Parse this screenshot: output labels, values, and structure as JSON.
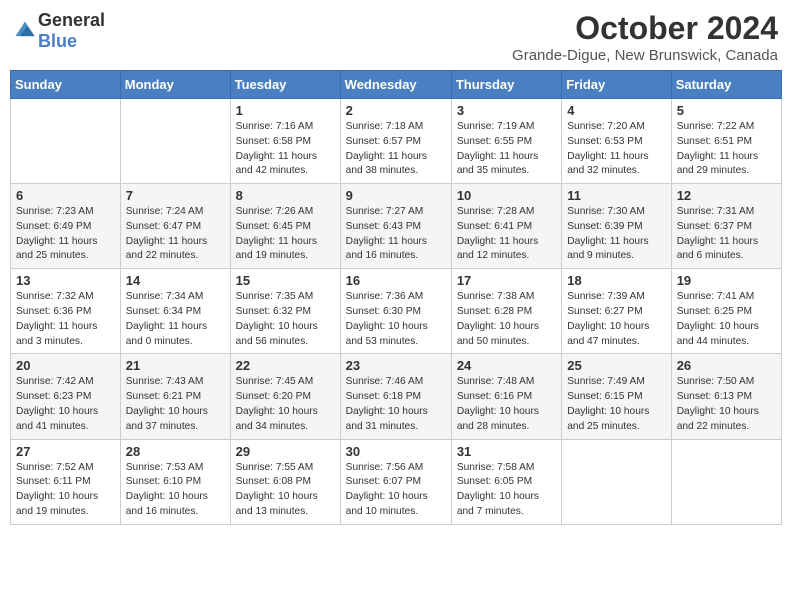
{
  "header": {
    "logo_general": "General",
    "logo_blue": "Blue",
    "month": "October 2024",
    "location": "Grande-Digue, New Brunswick, Canada"
  },
  "days_of_week": [
    "Sunday",
    "Monday",
    "Tuesday",
    "Wednesday",
    "Thursday",
    "Friday",
    "Saturday"
  ],
  "weeks": [
    [
      {
        "day": "",
        "info": ""
      },
      {
        "day": "",
        "info": ""
      },
      {
        "day": "1",
        "info": "Sunrise: 7:16 AM\nSunset: 6:58 PM\nDaylight: 11 hours and 42 minutes."
      },
      {
        "day": "2",
        "info": "Sunrise: 7:18 AM\nSunset: 6:57 PM\nDaylight: 11 hours and 38 minutes."
      },
      {
        "day": "3",
        "info": "Sunrise: 7:19 AM\nSunset: 6:55 PM\nDaylight: 11 hours and 35 minutes."
      },
      {
        "day": "4",
        "info": "Sunrise: 7:20 AM\nSunset: 6:53 PM\nDaylight: 11 hours and 32 minutes."
      },
      {
        "day": "5",
        "info": "Sunrise: 7:22 AM\nSunset: 6:51 PM\nDaylight: 11 hours and 29 minutes."
      }
    ],
    [
      {
        "day": "6",
        "info": "Sunrise: 7:23 AM\nSunset: 6:49 PM\nDaylight: 11 hours and 25 minutes."
      },
      {
        "day": "7",
        "info": "Sunrise: 7:24 AM\nSunset: 6:47 PM\nDaylight: 11 hours and 22 minutes."
      },
      {
        "day": "8",
        "info": "Sunrise: 7:26 AM\nSunset: 6:45 PM\nDaylight: 11 hours and 19 minutes."
      },
      {
        "day": "9",
        "info": "Sunrise: 7:27 AM\nSunset: 6:43 PM\nDaylight: 11 hours and 16 minutes."
      },
      {
        "day": "10",
        "info": "Sunrise: 7:28 AM\nSunset: 6:41 PM\nDaylight: 11 hours and 12 minutes."
      },
      {
        "day": "11",
        "info": "Sunrise: 7:30 AM\nSunset: 6:39 PM\nDaylight: 11 hours and 9 minutes."
      },
      {
        "day": "12",
        "info": "Sunrise: 7:31 AM\nSunset: 6:37 PM\nDaylight: 11 hours and 6 minutes."
      }
    ],
    [
      {
        "day": "13",
        "info": "Sunrise: 7:32 AM\nSunset: 6:36 PM\nDaylight: 11 hours and 3 minutes."
      },
      {
        "day": "14",
        "info": "Sunrise: 7:34 AM\nSunset: 6:34 PM\nDaylight: 11 hours and 0 minutes."
      },
      {
        "day": "15",
        "info": "Sunrise: 7:35 AM\nSunset: 6:32 PM\nDaylight: 10 hours and 56 minutes."
      },
      {
        "day": "16",
        "info": "Sunrise: 7:36 AM\nSunset: 6:30 PM\nDaylight: 10 hours and 53 minutes."
      },
      {
        "day": "17",
        "info": "Sunrise: 7:38 AM\nSunset: 6:28 PM\nDaylight: 10 hours and 50 minutes."
      },
      {
        "day": "18",
        "info": "Sunrise: 7:39 AM\nSunset: 6:27 PM\nDaylight: 10 hours and 47 minutes."
      },
      {
        "day": "19",
        "info": "Sunrise: 7:41 AM\nSunset: 6:25 PM\nDaylight: 10 hours and 44 minutes."
      }
    ],
    [
      {
        "day": "20",
        "info": "Sunrise: 7:42 AM\nSunset: 6:23 PM\nDaylight: 10 hours and 41 minutes."
      },
      {
        "day": "21",
        "info": "Sunrise: 7:43 AM\nSunset: 6:21 PM\nDaylight: 10 hours and 37 minutes."
      },
      {
        "day": "22",
        "info": "Sunrise: 7:45 AM\nSunset: 6:20 PM\nDaylight: 10 hours and 34 minutes."
      },
      {
        "day": "23",
        "info": "Sunrise: 7:46 AM\nSunset: 6:18 PM\nDaylight: 10 hours and 31 minutes."
      },
      {
        "day": "24",
        "info": "Sunrise: 7:48 AM\nSunset: 6:16 PM\nDaylight: 10 hours and 28 minutes."
      },
      {
        "day": "25",
        "info": "Sunrise: 7:49 AM\nSunset: 6:15 PM\nDaylight: 10 hours and 25 minutes."
      },
      {
        "day": "26",
        "info": "Sunrise: 7:50 AM\nSunset: 6:13 PM\nDaylight: 10 hours and 22 minutes."
      }
    ],
    [
      {
        "day": "27",
        "info": "Sunrise: 7:52 AM\nSunset: 6:11 PM\nDaylight: 10 hours and 19 minutes."
      },
      {
        "day": "28",
        "info": "Sunrise: 7:53 AM\nSunset: 6:10 PM\nDaylight: 10 hours and 16 minutes."
      },
      {
        "day": "29",
        "info": "Sunrise: 7:55 AM\nSunset: 6:08 PM\nDaylight: 10 hours and 13 minutes."
      },
      {
        "day": "30",
        "info": "Sunrise: 7:56 AM\nSunset: 6:07 PM\nDaylight: 10 hours and 10 minutes."
      },
      {
        "day": "31",
        "info": "Sunrise: 7:58 AM\nSunset: 6:05 PM\nDaylight: 10 hours and 7 minutes."
      },
      {
        "day": "",
        "info": ""
      },
      {
        "day": "",
        "info": ""
      }
    ]
  ]
}
